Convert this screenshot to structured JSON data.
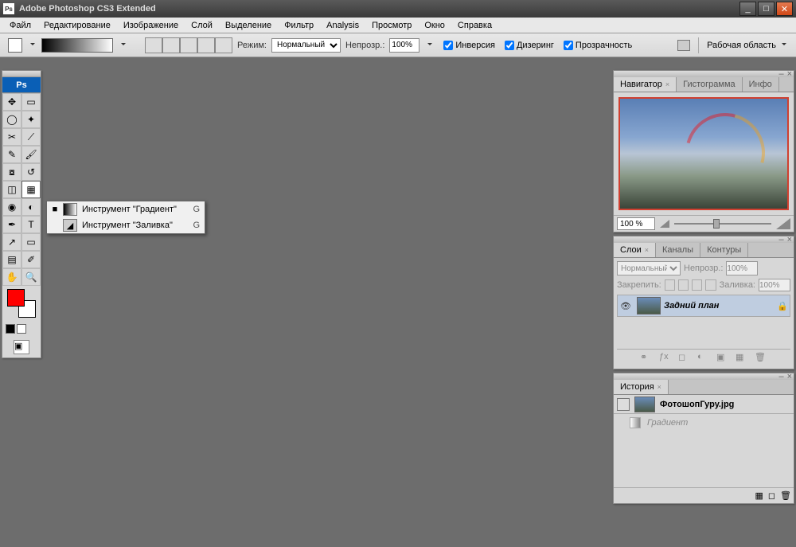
{
  "titlebar": {
    "title": "Adobe Photoshop CS3 Extended"
  },
  "menu": [
    "Файл",
    "Редактирование",
    "Изображение",
    "Слой",
    "Выделение",
    "Фильтр",
    "Analysis",
    "Просмотр",
    "Окно",
    "Справка"
  ],
  "options": {
    "mode_label": "Режим:",
    "mode_value": "Нормальный",
    "opacity_label": "Непрозр.:",
    "opacity_value": "100%",
    "chk_invert": "Инверсия",
    "chk_dither": "Дизеринг",
    "chk_transp": "Прозрачность",
    "workspace": "Рабочая область"
  },
  "tool_flyout": {
    "items": [
      {
        "label": "Инструмент \"Градиент\"",
        "key": "G",
        "active": true,
        "icon": "gradient"
      },
      {
        "label": "Инструмент \"Заливка\"",
        "key": "G",
        "active": false,
        "icon": "bucket"
      }
    ]
  },
  "navigator": {
    "tabs": [
      "Навигатор",
      "Гистограмма",
      "Инфо"
    ],
    "zoom": "100 %"
  },
  "layers": {
    "tabs": [
      "Слои",
      "Каналы",
      "Контуры"
    ],
    "blend": "Нормальный",
    "opacity_label": "Непрозр.:",
    "opacity_value": "100%",
    "lock_label": "Закрепить:",
    "fill_label": "Заливка:",
    "fill_value": "100%",
    "layer_name": "Задний план"
  },
  "history": {
    "tab": "История",
    "doc_name": "ФотошопГуру.jpg",
    "step1": "Градиент"
  }
}
